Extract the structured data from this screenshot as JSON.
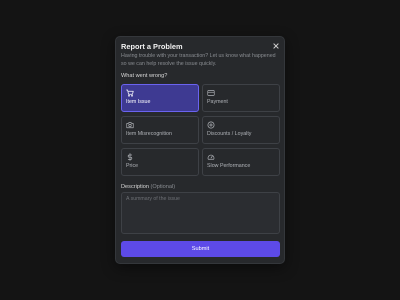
{
  "modal": {
    "title": "Report a Problem",
    "subtitle": "Having trouble with your transaction? Let us know what happened so we can help resolve the issue quickly.",
    "close_icon": "close-icon"
  },
  "issue_section": {
    "label": "What went wrong?",
    "selected": "Item Issue",
    "options": [
      {
        "label": "Item Issue",
        "icon": "cart-icon",
        "selected": true
      },
      {
        "label": "Payment",
        "icon": "credit-card-icon",
        "selected": false
      },
      {
        "label": "Item Misrecognition",
        "icon": "camera-icon",
        "selected": false
      },
      {
        "label": "Discounts / Loyalty",
        "icon": "plus-circle-icon",
        "selected": false
      },
      {
        "label": "Price",
        "icon": "dollar-icon",
        "selected": false
      },
      {
        "label": "Slow Performance",
        "icon": "gauge-icon",
        "selected": false
      }
    ]
  },
  "description": {
    "label": "Description",
    "optional_text": "(Optional)",
    "placeholder": "A summary of the issue",
    "value": ""
  },
  "submit": {
    "label": "Submit"
  },
  "colors": {
    "background": "#141414",
    "modal": "#27292c",
    "accent": "#5d4ae8",
    "selected_fill": "#3e3a92",
    "selected_border": "#6a63ef"
  }
}
